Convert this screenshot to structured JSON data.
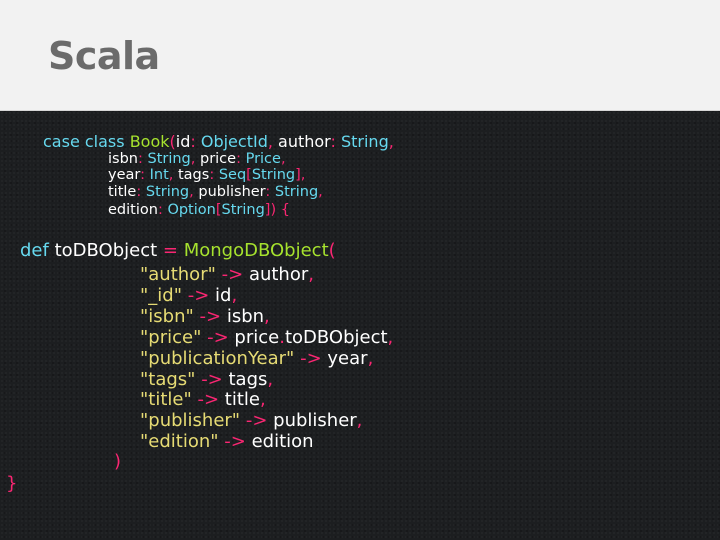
{
  "slide": {
    "title": "Scala"
  },
  "code": {
    "line1": {
      "kw_case": "case",
      "kw_class": "class",
      "class_name": "Book",
      "paren": "(",
      "p_id": "id",
      "c1": ":",
      "t_objectid": "ObjectId",
      "comma1": ",",
      "p_author": "author",
      "c2": ":",
      "t_string1": "String",
      "comma2": ","
    },
    "line2": {
      "p_isbn": "isbn",
      "c1": ":",
      "t_string": "String",
      "comma1": ",",
      "p_price": "price",
      "c2": ":",
      "t_price": "Price",
      "comma2": ","
    },
    "line3": {
      "p_year": "year",
      "c1": ":",
      "t_int": "Int",
      "comma1": ",",
      "p_tags": "tags",
      "c2": ":",
      "t_seq": "Seq",
      "lb": "[",
      "t_string": "String",
      "rb": "]",
      "comma2": ","
    },
    "line4": {
      "p_title": "title",
      "c1": ":",
      "t_string1": "String",
      "comma1": ",",
      "p_publisher": "publisher",
      "c2": ":",
      "t_string2": "String",
      "comma2": ","
    },
    "line5": {
      "p_edition": "edition",
      "c1": ":",
      "t_option": "Option",
      "lb": "[",
      "t_string": "String",
      "rb": "]",
      "close": ")",
      "brace": "{"
    },
    "def_line": {
      "kw_def": "def",
      "name": "toDBObject",
      "eq": "=",
      "ctor": "MongoDBObject",
      "paren": "("
    },
    "mappings": [
      {
        "key": "\"author\"",
        "arrow": "->",
        "value": "author",
        "comma": ","
      },
      {
        "key": "\"_id\"",
        "arrow": "->",
        "value": "id",
        "comma": ","
      },
      {
        "key": "\"isbn\"",
        "arrow": "->",
        "value": "isbn",
        "comma": ","
      },
      {
        "key": "\"price\"",
        "arrow": "->",
        "value": "price",
        "dot": ".",
        "method": "toDBObject",
        "comma": ","
      },
      {
        "key": "\"publicationYear\"",
        "arrow": "->",
        "value": "year",
        "comma": ","
      },
      {
        "key": "\"tags\"",
        "arrow": "->",
        "value": "tags",
        "comma": ","
      },
      {
        "key": "\"title\"",
        "arrow": "->",
        "value": "title",
        "comma": ","
      },
      {
        "key": "\"publisher\"",
        "arrow": "->",
        "value": "publisher",
        "comma": ","
      },
      {
        "key": "\"edition\"",
        "arrow": "->",
        "value": "edition",
        "comma": ""
      }
    ],
    "close_paren": ")",
    "close_brace": "}"
  },
  "colors": {
    "keyword": "#66d9ef",
    "class_name": "#a6e22e",
    "punctuation": "#f92672",
    "string": "#e6db74",
    "text": "#ffffff",
    "header_bg": "#f2f2f2",
    "title": "#6b6b6b",
    "code_bg": "#1c1e20"
  }
}
